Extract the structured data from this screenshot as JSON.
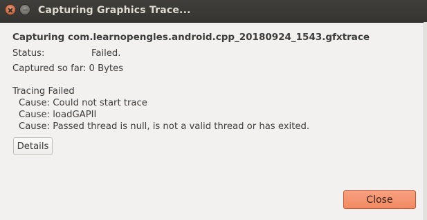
{
  "window": {
    "title": "Capturing Graphics Trace..."
  },
  "capture": {
    "heading": "Capturing com.learnopengles.android.cpp_20180924_1543.gfxtrace",
    "status_label": "Status:",
    "status_value": "Failed.",
    "captured_label": "Captured so far:",
    "captured_value": "0 Bytes"
  },
  "error": {
    "title": "Tracing Failed",
    "causes": [
      "Cause: Could not start trace",
      "Cause: loadGAPII",
      "Cause: Passed thread is null, is not a valid thread or has exited."
    ]
  },
  "buttons": {
    "details_label": "Details",
    "close_label": "Close"
  },
  "colors": {
    "titlebar": "#3c3b37",
    "accent_button": "#f18a63",
    "background": "#f2f1f0"
  },
  "icons": {
    "window_close": "close-icon",
    "window_minimize": "minimize-icon"
  }
}
